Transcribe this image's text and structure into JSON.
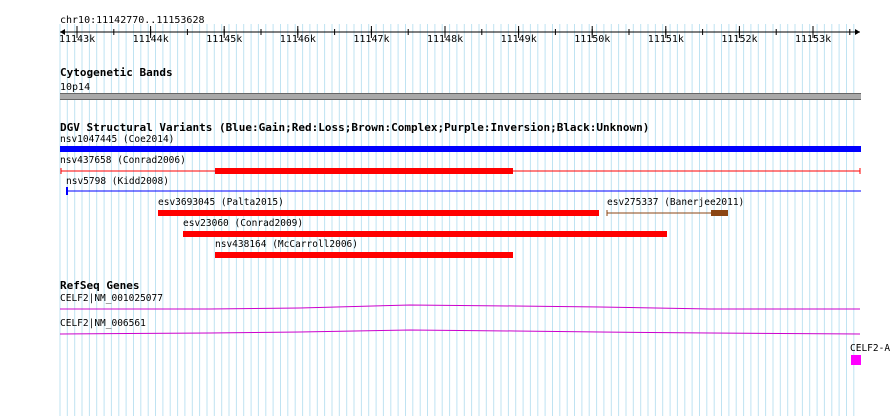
{
  "ruler": {
    "location": "chr10:11142770..11153628",
    "ticks": [
      "11143k",
      "11144k",
      "11145k",
      "11146k",
      "11147k",
      "11148k",
      "11149k",
      "11150k",
      "11151k",
      "11152k",
      "11153k"
    ]
  },
  "cytoband_track": {
    "title": "Cytogenetic Bands",
    "band_label": "10p14"
  },
  "dgv_track": {
    "title": "DGV Structural Variants (Blue:Gain;Red:Loss;Brown:Complex;Purple:Inversion;Black:Unknown)",
    "features": [
      {
        "label": "nsv1047445 (Coe2014)",
        "type": "Gain",
        "color": "#0000ff"
      },
      {
        "label": "nsv437658 (Conrad2006)",
        "type": "Loss",
        "color": "#ff0000"
      },
      {
        "label": "nsv5798 (Kidd2008)",
        "type": "Gain",
        "color": "#0000ff"
      },
      {
        "label": "esv3693045 (Palta2015)",
        "type": "Loss",
        "color": "#ff0000"
      },
      {
        "label": "esv275337 (Banerjee2011)",
        "type": "Complex",
        "color": "#8b4513"
      },
      {
        "label": "esv23060 (Conrad2009)",
        "type": "Loss",
        "color": "#ff0000"
      },
      {
        "label": "nsv438164 (McCarroll2006)",
        "type": "Loss",
        "color": "#ff0000"
      }
    ]
  },
  "refseq_track": {
    "title": "RefSeq Genes",
    "genes": [
      {
        "label": "CELF2|NM_001025077",
        "color": "#cc00cc"
      },
      {
        "label": "CELF2|NM_006561",
        "color": "#cc00cc"
      },
      {
        "label": "CELF2-A",
        "color": "#ff00ff"
      }
    ]
  },
  "colors": {
    "grid": "#bfe3f2",
    "axis": "#000000",
    "band": "#a9a9a9"
  }
}
